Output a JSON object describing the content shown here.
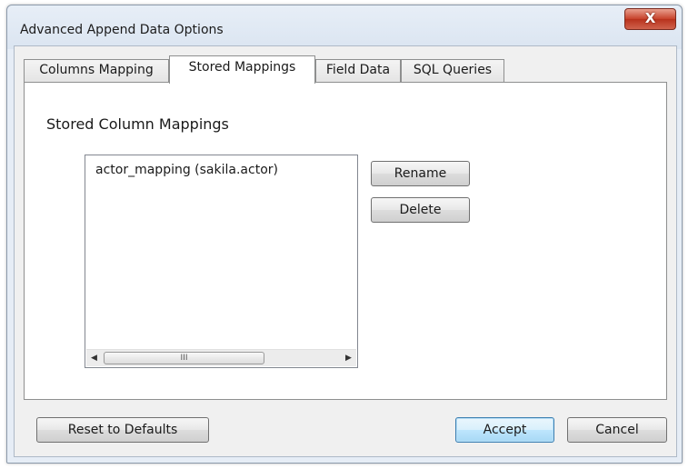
{
  "window": {
    "title": "Advanced Append Data Options",
    "close_glyph": "X"
  },
  "tabs": [
    {
      "label": "Columns Mapping",
      "active": false
    },
    {
      "label": "Stored Mappings",
      "active": true
    },
    {
      "label": "Field Data",
      "active": false
    },
    {
      "label": "SQL Queries",
      "active": false
    }
  ],
  "stored_mappings": {
    "section_label": "Stored Column Mappings",
    "items": [
      "actor_mapping (sakila.actor)"
    ],
    "rename_label": "Rename",
    "delete_label": "Delete",
    "scroll_left_glyph": "◀",
    "scroll_right_glyph": "▶",
    "scroll_thumb_grip": "III"
  },
  "footer": {
    "reset_label": "Reset to Defaults",
    "accept_label": "Accept",
    "cancel_label": "Cancel"
  },
  "colors": {
    "close_button": "#c6412a",
    "default_button_border": "#3c7fb1"
  }
}
